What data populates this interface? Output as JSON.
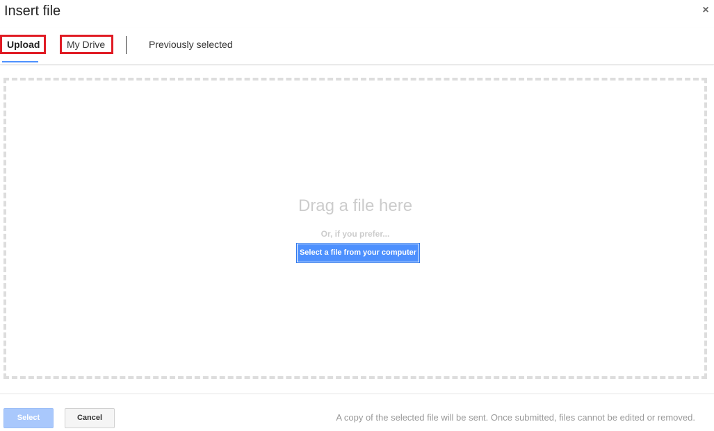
{
  "dialog": {
    "title": "Insert file",
    "close_icon": "×"
  },
  "tabs": [
    {
      "label": "Upload",
      "selected": true
    },
    {
      "label": "My Drive",
      "selected": false
    },
    {
      "label": "Previously selected",
      "selected": false
    }
  ],
  "dropzone": {
    "heading": "Drag a file here",
    "alt_text": "Or, if you prefer...",
    "select_button": "Select a file from your computer"
  },
  "footer": {
    "select_label": "Select",
    "cancel_label": "Cancel",
    "note": "A copy of the selected file will be sent. Once submitted, files cannot be edited or removed."
  },
  "colors": {
    "accent": "#4d90fe",
    "highlight_outline": "#e01b24"
  }
}
